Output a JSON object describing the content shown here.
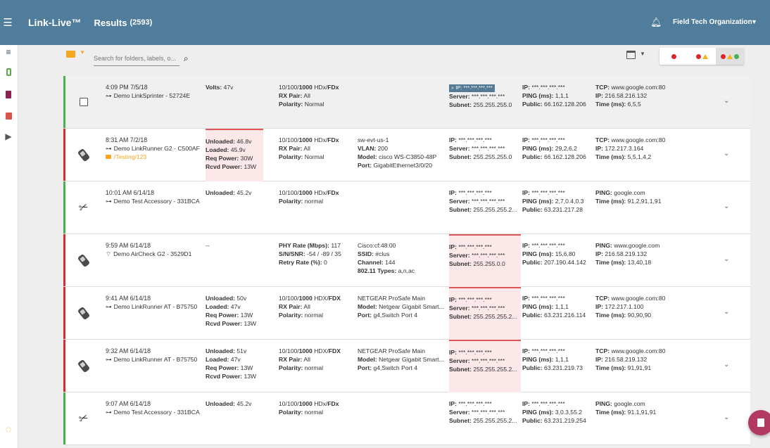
{
  "app": {
    "brand": "Link-Live™",
    "page_title": "Results",
    "count": "(2593)",
    "organization": "Field Tech Organization"
  },
  "search": {
    "placeholder": "Search for folders, labels, o..."
  },
  "rows": [
    {
      "status": "green",
      "icon": "checkbox",
      "selected": true,
      "time": "4:09 PM  7/5/18",
      "device": "Demo LinkSprinter - 52724E",
      "device_icon": "wired",
      "power": [
        {
          "label": "Volts:",
          "value": " 47v"
        }
      ],
      "link": [
        {
          "label": "",
          "value": "10/100/",
          "bold": "1000",
          "tail": " HDx/",
          "bold2": "FDx"
        },
        {
          "label": "RX Pair:",
          "value": " All"
        },
        {
          "label": "Polarity:",
          "value": " Normal"
        }
      ],
      "dhcp_chip": "IP: ***.***.***.***",
      "dhcp": [
        {
          "label": "Server:",
          "value": " ***.***.***.***"
        },
        {
          "label": "Subnet:",
          "value": " 255.255.255.0"
        }
      ],
      "dns": [
        {
          "label": "IP:",
          "value": " ***.***.***.***"
        },
        {
          "label": "PING (ms):",
          "value": " 1,1,1"
        },
        {
          "label": "Public:",
          "value": " 66.162.128.206"
        }
      ],
      "tcp": [
        {
          "label": "TCP:",
          "value": " www.google.com:80"
        },
        {
          "label": "IP:",
          "value": " 216.58.216.132"
        },
        {
          "label": "Time (ms):",
          "value": " 6,5,5"
        }
      ]
    },
    {
      "status": "red",
      "icon": "handheld",
      "time": "8:31 AM  7/2/18",
      "device": "Demo LinkRunner G2 - C500AF",
      "device_icon": "wired",
      "folder": "/Testing/123",
      "power_warn": true,
      "power": [
        {
          "label": "Unloaded:",
          "value": " 46.8v"
        },
        {
          "label": "Loaded:",
          "value": " 45.9v"
        },
        {
          "label": "Req Power:",
          "value": " 30W"
        },
        {
          "label": "Rcvd Power:",
          "value": " 13W"
        }
      ],
      "link": [
        {
          "label": "",
          "value": "10/100/",
          "bold": "1000",
          "tail": " HDx/",
          "bold2": "FDx"
        },
        {
          "label": "RX Pair:",
          "value": " All"
        },
        {
          "label": "Polarity:",
          "value": " Normal"
        }
      ],
      "switch": [
        {
          "label": "",
          "value": "sw-evt-us-1"
        },
        {
          "label": "VLAN:",
          "value": " 200"
        },
        {
          "label": "Model:",
          "value": " cisco WS-C3850-48P"
        },
        {
          "label": "Port:",
          "value": " GigabitEthernet3/0/20"
        }
      ],
      "dhcp": [
        {
          "label": "IP:",
          "value": " ***.***.***.***"
        },
        {
          "label": "Server:",
          "value": " ***.***.***.***"
        },
        {
          "label": "Subnet:",
          "value": " 255.255.255.0"
        }
      ],
      "dns": [
        {
          "label": "IP:",
          "value": " ***.***.***.***"
        },
        {
          "label": "PING (ms):",
          "value": " 29,2,6,2"
        },
        {
          "label": "Public:",
          "value": " 66.162.128.206"
        }
      ],
      "tcp": [
        {
          "label": "TCP:",
          "value": " www.google.com:80"
        },
        {
          "label": "IP:",
          "value": " 172.217.3.164"
        },
        {
          "label": "Time (ms):",
          "value": " 5,5,1,4,2"
        }
      ]
    },
    {
      "status": "green",
      "icon": "accessory",
      "time": "10:01 AM  6/14/18",
      "device": "Demo Test Accessory - 331BCA",
      "device_icon": "wired",
      "power": [
        {
          "label": "Unloaded:",
          "value": " 45.2v"
        }
      ],
      "link": [
        {
          "label": "",
          "value": "10/100/",
          "bold": "1000",
          "tail": " HDx/",
          "bold2": "FDx"
        },
        {
          "label": "Polarity:",
          "value": " normal"
        }
      ],
      "dhcp": [
        {
          "label": "IP:",
          "value": " ***.***.***.***"
        },
        {
          "label": "Server:",
          "value": " ***.***.***.***"
        },
        {
          "label": "Subnet:",
          "value": " 255.255.255.2..."
        }
      ],
      "dns": [
        {
          "label": "IP:",
          "value": " ***.***.***.***"
        },
        {
          "label": "PING (ms):",
          "value": " 2,7,0.4,0.3"
        },
        {
          "label": "Public:",
          "value": " 63.231.217.28"
        }
      ],
      "tcp": [
        {
          "label": "PING:",
          "value": " google.com"
        },
        {
          "label": "Time (ms):",
          "value": " 91.2,91.1,91"
        }
      ]
    },
    {
      "status": "red",
      "icon": "handheld",
      "time": "9:59 AM  6/14/18",
      "device": "Demo AirCheck G2 - 3529D1",
      "device_icon": "wifi",
      "power": [
        {
          "label": "",
          "value": "--"
        }
      ],
      "link": [
        {
          "label": "PHY Rate (Mbps):",
          "value": " 117"
        },
        {
          "label": "S/N/SNR:",
          "value": " -54 / -89 / 35"
        },
        {
          "label": "Retry Rate (%):",
          "value": " 0"
        }
      ],
      "switch": [
        {
          "label": "",
          "value": "Cisco:cf:48:00"
        },
        {
          "label": "SSID:",
          "value": " #clus"
        },
        {
          "label": "Channel:",
          "value": " 144"
        },
        {
          "label": "802.11 Types:",
          "value": " a,n,ac"
        }
      ],
      "dhcp_warn": true,
      "dhcp": [
        {
          "label": "IP:",
          "value": " ***.***.***.***"
        },
        {
          "label": "Server:",
          "value": " ***.***.***.***"
        },
        {
          "label": "Subnet:",
          "value": " 255.255.0.0"
        }
      ],
      "dns": [
        {
          "label": "IP:",
          "value": " ***.***.***.***"
        },
        {
          "label": "PING (ms):",
          "value": " 15,6,80"
        },
        {
          "label": "Public:",
          "value": " 207.190.44.142"
        }
      ],
      "tcp": [
        {
          "label": "PING:",
          "value": " www.google.com"
        },
        {
          "label": "IP:",
          "value": " 216.58.219.132"
        },
        {
          "label": "Time (ms):",
          "value": " 13,40,18"
        }
      ]
    },
    {
      "status": "red",
      "icon": "handheld",
      "time": "9:41 AM  6/14/18",
      "device": "Demo LinkRunner AT - B75750",
      "device_icon": "wired",
      "power": [
        {
          "label": "Unloaded:",
          "value": " 50v"
        },
        {
          "label": "Loaded:",
          "value": " 47v"
        },
        {
          "label": "Req Power:",
          "value": " 13W"
        },
        {
          "label": "Rcvd Power:",
          "value": " 13W"
        }
      ],
      "link": [
        {
          "label": "",
          "value": "10/100/",
          "bold": "1000",
          "tail": " HDX/",
          "bold2": "FDX"
        },
        {
          "label": "RX Pair:",
          "value": " All"
        },
        {
          "label": "Polarity:",
          "value": " normal"
        }
      ],
      "switch": [
        {
          "label": "",
          "value": "NETGEAR ProSafe Main"
        },
        {
          "label": "Model:",
          "value": " Netgear Gigabit Smart..."
        },
        {
          "label": "Port:",
          "value": " g4,Switch Port 4"
        }
      ],
      "dhcp_warn": true,
      "dhcp": [
        {
          "label": "IP:",
          "value": " ***.***.***.***"
        },
        {
          "label": "Server:",
          "value": " ***.***.***.***"
        },
        {
          "label": "Subnet:",
          "value": " 255.255.255.2..."
        }
      ],
      "dns": [
        {
          "label": "IP:",
          "value": " ***.***.***.***"
        },
        {
          "label": "PING (ms):",
          "value": " 1,1,1"
        },
        {
          "label": "Public:",
          "value": " 63.231.216.114"
        }
      ],
      "tcp": [
        {
          "label": "TCP:",
          "value": " www.google.com:80"
        },
        {
          "label": "IP:",
          "value": " 172.217.1.100"
        },
        {
          "label": "Time (ms):",
          "value": " 90,90,90"
        }
      ]
    },
    {
      "status": "red",
      "icon": "handheld",
      "time": "9:32 AM  6/14/18",
      "device": "Demo LinkRunner AT - B75750",
      "device_icon": "wired",
      "power": [
        {
          "label": "Unloaded:",
          "value": " 51v"
        },
        {
          "label": "Loaded:",
          "value": " 47v"
        },
        {
          "label": "Req Power:",
          "value": " 13W"
        },
        {
          "label": "Rcvd Power:",
          "value": " 13W"
        }
      ],
      "link": [
        {
          "label": "",
          "value": "10/100/",
          "bold": "1000",
          "tail": " HDX/",
          "bold2": "FDX"
        },
        {
          "label": "RX Pair:",
          "value": " All"
        },
        {
          "label": "Polarity:",
          "value": " normal"
        }
      ],
      "switch": [
        {
          "label": "",
          "value": "NETGEAR ProSafe Main"
        },
        {
          "label": "Model:",
          "value": " Netgear Gigabit Smart..."
        },
        {
          "label": "Port:",
          "value": " g4,Switch Port 4"
        }
      ],
      "dhcp_warn": true,
      "dhcp": [
        {
          "label": "IP:",
          "value": " ***.***.***.***"
        },
        {
          "label": "Server:",
          "value": " ***.***.***.***"
        },
        {
          "label": "Subnet:",
          "value": " 255.255.255.2..."
        }
      ],
      "dns": [
        {
          "label": "IP:",
          "value": " ***.***.***.***"
        },
        {
          "label": "PING (ms):",
          "value": " 1,1,1"
        },
        {
          "label": "Public:",
          "value": " 63.231.219.73"
        }
      ],
      "tcp": [
        {
          "label": "TCP:",
          "value": " www.google.com:80"
        },
        {
          "label": "IP:",
          "value": " 216.58.219.132"
        },
        {
          "label": "Time (ms):",
          "value": " 91,91,91"
        }
      ]
    },
    {
      "status": "green",
      "icon": "accessory",
      "time": "9:07 AM  6/14/18",
      "device": "Demo Test Accessory - 331BCA",
      "device_icon": "wired",
      "power": [
        {
          "label": "Unloaded:",
          "value": " 45.2v"
        }
      ],
      "link": [
        {
          "label": "",
          "value": "10/100/",
          "bold": "1000",
          "tail": " HDx/",
          "bold2": "FDx"
        },
        {
          "label": "Polarity:",
          "value": " normal"
        }
      ],
      "dhcp": [
        {
          "label": "IP:",
          "value": " ***.***.***.***"
        },
        {
          "label": "Server:",
          "value": " ***.***.***.***"
        },
        {
          "label": "Subnet:",
          "value": " 255.255.255.2..."
        }
      ],
      "dns": [
        {
          "label": "IP:",
          "value": " ***.***.***.***"
        },
        {
          "label": "PING (ms):",
          "value": " 3,0.3,55.2"
        },
        {
          "label": "Public:",
          "value": " 63.231.219.254"
        }
      ],
      "tcp": [
        {
          "label": "PING:",
          "value": " google.com"
        },
        {
          "label": "Time (ms):",
          "value": " 91.1,91,91"
        }
      ]
    }
  ]
}
